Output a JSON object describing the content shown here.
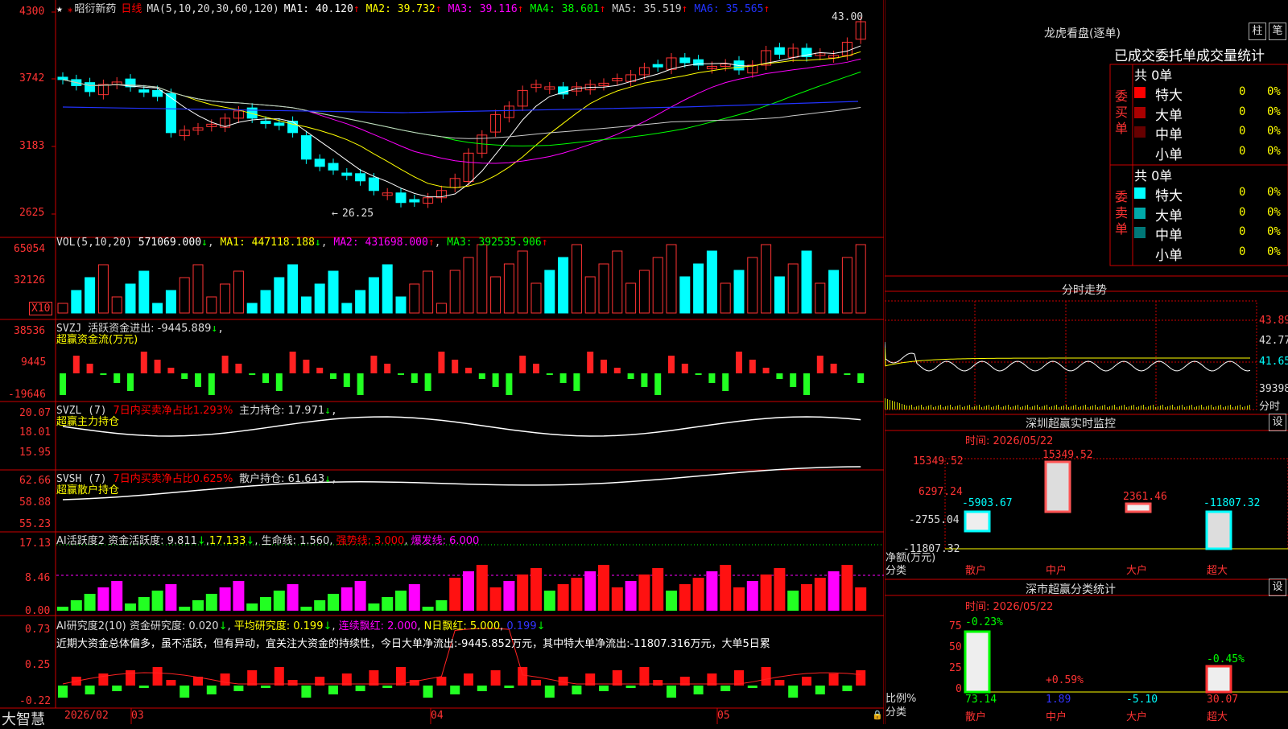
{
  "stock": {
    "name": "昭衍新药",
    "period": "日线",
    "ma_label": "MA(5,10,20,30,60,120)"
  },
  "price_axis": [
    "4300",
    "3742",
    "3183",
    "2625"
  ],
  "ma_values": [
    {
      "label": "MA1: 40.120",
      "arrow": "↑",
      "color": "#ffffff"
    },
    {
      "label": "MA2: 39.732",
      "arrow": "↑",
      "color": "#ffff00"
    },
    {
      "label": "MA3: 39.116",
      "arrow": "↑",
      "color": "#ff00ff"
    },
    {
      "label": "MA4: 38.601",
      "arrow": "↑",
      "color": "#00ff00"
    },
    {
      "label": "MA5: 35.519",
      "arrow": "↑",
      "color": "#cccccc"
    },
    {
      "label": "MA6: 35.565",
      "arrow": "↑",
      "color": "#2233ff"
    }
  ],
  "high_marker": "43.00",
  "low_marker": "26.25",
  "vol": {
    "header": "VOL(5,10,20)",
    "value": "571069.000",
    "ma1": "MA1: 447118.188",
    "ma2": "MA2: 431698.000",
    "ma3": "MA3: 392535.906",
    "axis": [
      "65054",
      "32126"
    ],
    "unit": "X10"
  },
  "svzj": {
    "header": "SVZJ",
    "line1": "活跃资金进出: -9445.889",
    "line2": "超赢资金流(万元)",
    "axis": [
      "38536",
      "9445",
      "-19646"
    ]
  },
  "svzl": {
    "header": "SVZL (7)",
    "p1": "7日内买卖净占比1.293%",
    "p2": "主力持仓: 17.971",
    "line2": "超赢主力持仓",
    "axis": [
      "20.07",
      "18.01",
      "15.95"
    ]
  },
  "svsh": {
    "header": "SVSH (7)",
    "p1": "7日内买卖净占比0.625%",
    "p2": "散户持仓: 61.643",
    "line2": "超赢散户持仓",
    "axis": [
      "62.66",
      "58.88",
      "55.23"
    ]
  },
  "ai2": {
    "header": "AI活跃度2",
    "p1": "资金活跃度: 9.811",
    "p2": "17.133",
    "p3": "生命线: 1.560",
    "p4": "强势线: 3.000",
    "p5": "爆发线: 6.000",
    "axis": [
      "17.13",
      "8.46",
      "0.00"
    ]
  },
  "ai_research": {
    "header": "AI研究度2(10)",
    "p1": "资金研究度: 0.020",
    "p2": "平均研究度: 0.199",
    "p3": "连续飘红: 2.000",
    "p4": "N日飘红: 5.000",
    "p5": "0.199",
    "commentary": "近期大资金总体偏多，虽不活跃，但有异动，宜关注大资金的持续性，今日大单净流出:-9445.852万元，其中特大单净流出:-11807.316万元，大单5日累",
    "axis": [
      "0.73",
      "0.25",
      "-0.22"
    ]
  },
  "footer": {
    "brand": "大智慧",
    "year": "2026/02",
    "months": [
      "03",
      "04",
      "05"
    ]
  },
  "dragon": {
    "title": "龙虎看盘(逐单)",
    "btn1": "柱",
    "btn2": "笔",
    "tabs": "已成交委托单成交量统计",
    "buy": {
      "label": "委买单",
      "total": "共 0单",
      "rows": [
        {
          "name": "特大",
          "v": "0",
          "p": "0%",
          "color": "#ff0000"
        },
        {
          "name": "大单",
          "v": "0",
          "p": "0%",
          "color": "#aa0000"
        },
        {
          "name": "中单",
          "v": "0",
          "p": "0%",
          "color": "#660000"
        },
        {
          "name": "小单",
          "v": "0",
          "p": "0%",
          "color": "#000000"
        }
      ]
    },
    "sell": {
      "label": "委卖单",
      "total": "共 0单",
      "rows": [
        {
          "name": "特大",
          "v": "0",
          "p": "0%",
          "color": "#00ffff"
        },
        {
          "name": "大单",
          "v": "0",
          "p": "0%",
          "color": "#00aaaa"
        },
        {
          "name": "中单",
          "v": "0",
          "p": "0%",
          "color": "#007777"
        },
        {
          "name": "小单",
          "v": "0",
          "p": "0%",
          "color": "#000000"
        }
      ]
    }
  },
  "intraday": {
    "title": "分时走势",
    "axis": [
      "43.89",
      "42.77",
      "41.65",
      "39398"
    ],
    "unit": "分时"
  },
  "sz_monitor": {
    "title": "深圳超赢实时监控",
    "btn": "设",
    "time": "时间: 2026/05/22",
    "axis": [
      "15349.52",
      "6297.24",
      "-2755.04",
      "-11807.32"
    ],
    "ylabel": "净额(万元)",
    "xlabel_left": "分类",
    "bars": [
      {
        "cat": "散户",
        "val": "-5903.67"
      },
      {
        "cat": "中户",
        "val": "15349.52"
      },
      {
        "cat": "大户",
        "val": "2361.46"
      },
      {
        "cat": "超大",
        "val": "-11807.32"
      }
    ]
  },
  "sz_stats": {
    "title": "深市超赢分类统计",
    "btn": "设",
    "time": "时间: 2026/05/22",
    "axis": [
      "75",
      "50",
      "25",
      "0"
    ],
    "ylabel": "比例%",
    "xlabel_left": "分类",
    "bars": [
      {
        "cat": "散户",
        "pct": "73.14",
        "chg": "-0.23%"
      },
      {
        "cat": "中户",
        "pct": "1.89",
        "chg": "+0.59%"
      },
      {
        "cat": "大户",
        "pct": "-5.10",
        "chg": ""
      },
      {
        "cat": "超大",
        "pct": "30.07",
        "chg": "-0.45%"
      }
    ]
  }
}
